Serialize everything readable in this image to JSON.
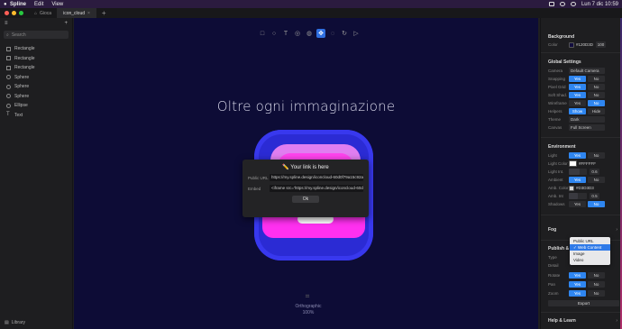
{
  "menubar": {
    "app": "Spline",
    "items": [
      "Edit",
      "View"
    ],
    "clock": "Lun 7 dic 10:59"
  },
  "tabs": [
    {
      "label": "Gioca"
    },
    {
      "label": "icon_cloud"
    }
  ],
  "left_panel": {
    "search_placeholder": "Search",
    "objects": [
      {
        "label": "Rectangle",
        "icon": "square-icon"
      },
      {
        "label": "Rectangle",
        "icon": "square-icon"
      },
      {
        "label": "Rectangle",
        "icon": "square-icon"
      },
      {
        "label": "Sphere",
        "icon": "circle-icon"
      },
      {
        "label": "Sphere",
        "icon": "circle-icon"
      },
      {
        "label": "Sphere",
        "icon": "circle-icon"
      },
      {
        "label": "Ellipse",
        "icon": "circle-icon"
      },
      {
        "label": "Text",
        "icon": "text-icon"
      }
    ],
    "library": "Library"
  },
  "canvas": {
    "headline": "Oltre ogni immaginazione",
    "view_mode": "Orthographic",
    "zoom": "100%"
  },
  "modal": {
    "title": "✏️ Your link is here",
    "public_url_label": "Public URL",
    "public_url_value": "https://my.spline.design/iconcloud-60d0f79a15c92a40e1",
    "embed_label": "Embed",
    "embed_value": "<iframe src='https://my.spline.design/iconcloud-60d0f79",
    "ok_label": "Ok"
  },
  "right_panel": {
    "background_title": "Background",
    "color_label": "Color",
    "color_hex": "#120D3D",
    "color_opacity": "100",
    "global_title": "Global Settings",
    "camera_label": "Camera",
    "camera_value": "Default Camera",
    "snapping_label": "Snapping",
    "pixel_grid_label": "Pixel Grid",
    "soft_shad_label": "Soft Shad.",
    "wireframe_label": "Wireframe",
    "helpers_label": "Helpers",
    "theme_label": "Theme",
    "theme_value": "Dark",
    "canvas_label": "Canvas",
    "canvas_value": "Full Screen",
    "yes": "Yes",
    "no": "No",
    "show": "Show",
    "hide": "Hide",
    "env_title": "Environment",
    "light_label": "Light",
    "light_color_label": "Light Color",
    "light_color_hex": "#FFFFFF",
    "light_int_label": "Light Int.",
    "light_int_value": "0.6",
    "ambient_label": "Ambient",
    "amb_color_label": "Amb. Color",
    "amb_color_hex": "#D3D3D3",
    "amb_int_label": "Amb. Int",
    "amb_int_value": "0.5",
    "shadows_label": "Shadows",
    "fog_title": "Fog",
    "publish_title": "Publish & Export",
    "type_label": "Type",
    "detail_label": "Detail",
    "rotate_label": "Rotate",
    "pan_label": "Pan",
    "zoom_label": "Zoom",
    "export_label": "Export",
    "help_title": "Help & Learn"
  },
  "type_dropdown": {
    "options": [
      "Public URL",
      "Web Content",
      "Image",
      "Video"
    ],
    "selected": "Web Content"
  },
  "colors": {
    "canvas_bg": "#0d0c36",
    "accent": "#2f86f0",
    "icon_blue": "#2b2bd4",
    "icon_pink": "#ff30f0"
  }
}
